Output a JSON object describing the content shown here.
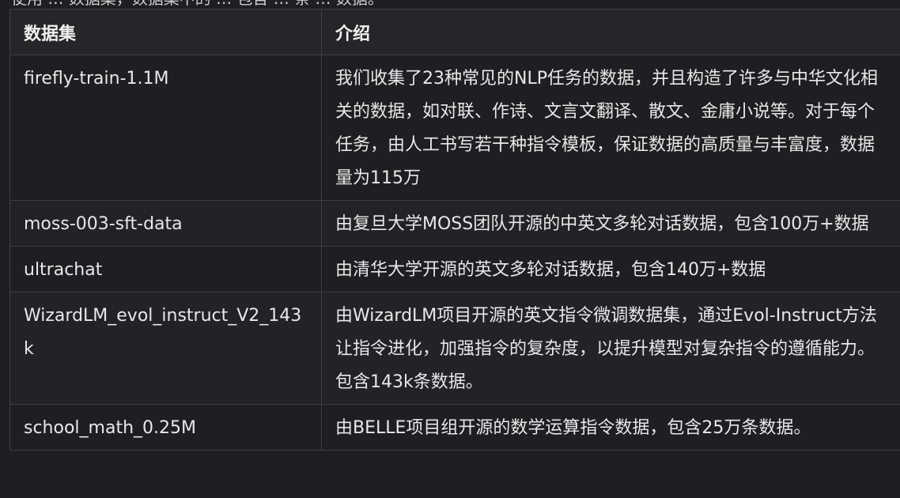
{
  "top_partial_text": "使用 … 数据集，数据集中的 … 包含 … 条 … 数据。",
  "table": {
    "headers": [
      "数据集",
      "介绍"
    ],
    "rows": [
      {
        "name": "firefly-train-1.1M",
        "desc": "我们收集了23种常见的NLP任务的数据，并且构造了许多与中华文化相关的数据，如对联、作诗、文言文翻译、散文、金庸小说等。对于每个任务，由人工书写若干种指令模板，保证数据的高质量与丰富度，数据量为115万"
      },
      {
        "name": "moss-003-sft-data",
        "desc": "由复旦大学MOSS团队开源的中英文多轮对话数据，包含100万+数据"
      },
      {
        "name": "ultrachat",
        "desc": "由清华大学开源的英文多轮对话数据，包含140万+数据"
      },
      {
        "name": "WizardLM_evol_instruct_V2_143k",
        "desc": "由WizardLM项目开源的英文指令微调数据集，通过Evol-Instruct方法让指令进化，加强指令的复杂度，以提升模型对复杂指令的遵循能力。包含143k条数据。"
      },
      {
        "name": "school_math_0.25M",
        "desc": "由BELLE项目组开源的数学运算指令数据，包含25万条数据。"
      }
    ]
  }
}
